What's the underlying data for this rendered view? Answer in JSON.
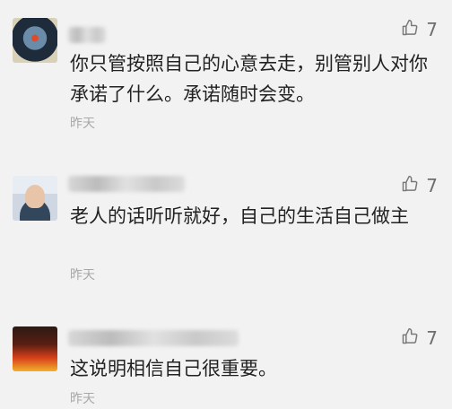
{
  "comments": [
    {
      "text": "你只管按照自己的心意去走，别管别人对你承诺了什么。承诺随时会变。",
      "time": "昨天",
      "likes": "7",
      "like_icon": "thumbs-up-icon"
    },
    {
      "text": "老人的话听听就好，自己的生活自己做主",
      "time": "昨天",
      "likes": "7",
      "like_icon": "thumbs-up-icon"
    },
    {
      "text": "这说明相信自己很重要。",
      "time": "昨天",
      "likes": "7",
      "like_icon": "thumbs-up-icon"
    }
  ]
}
